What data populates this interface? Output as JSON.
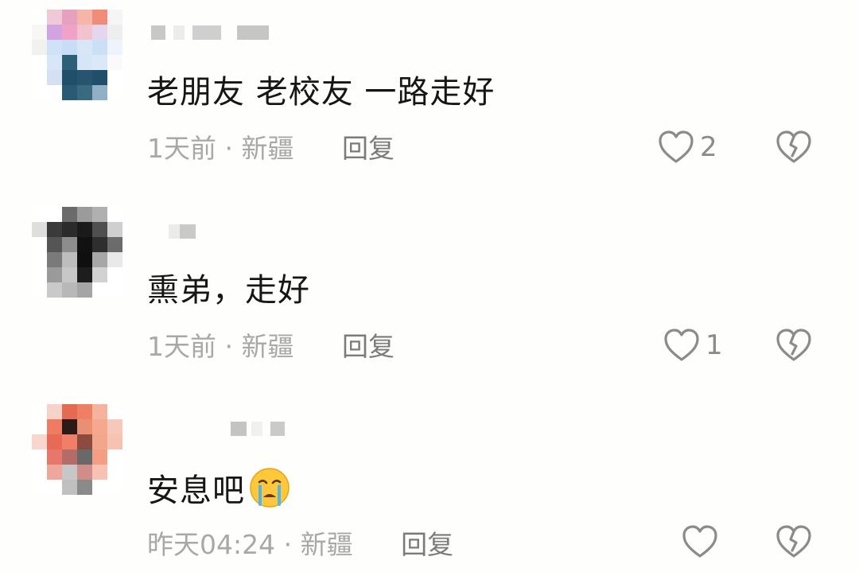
{
  "comments": [
    {
      "text": "老朋友 老校友 一路走好",
      "time": "1天前",
      "location": "新疆",
      "reply_label": "回复",
      "like_count": "2"
    },
    {
      "text": "熏弟，走好",
      "time": "1天前",
      "location": "新疆",
      "reply_label": "回复",
      "like_count": "1"
    },
    {
      "text": "安息吧",
      "emoji": "crying-face-icon",
      "time": "昨天04:24",
      "location": "新疆",
      "reply_label": "回复",
      "like_count": ""
    }
  ],
  "meta_separator": "·",
  "icons": {
    "like": "heart-outline-icon",
    "dislike": "broken-heart-icon"
  },
  "colors": {
    "background": "#fefefc",
    "comment_text": "#161616",
    "meta_text": "#a8a8a8",
    "reply_text": "#7b7b7b",
    "icon_stroke": "#8b8b8b"
  }
}
